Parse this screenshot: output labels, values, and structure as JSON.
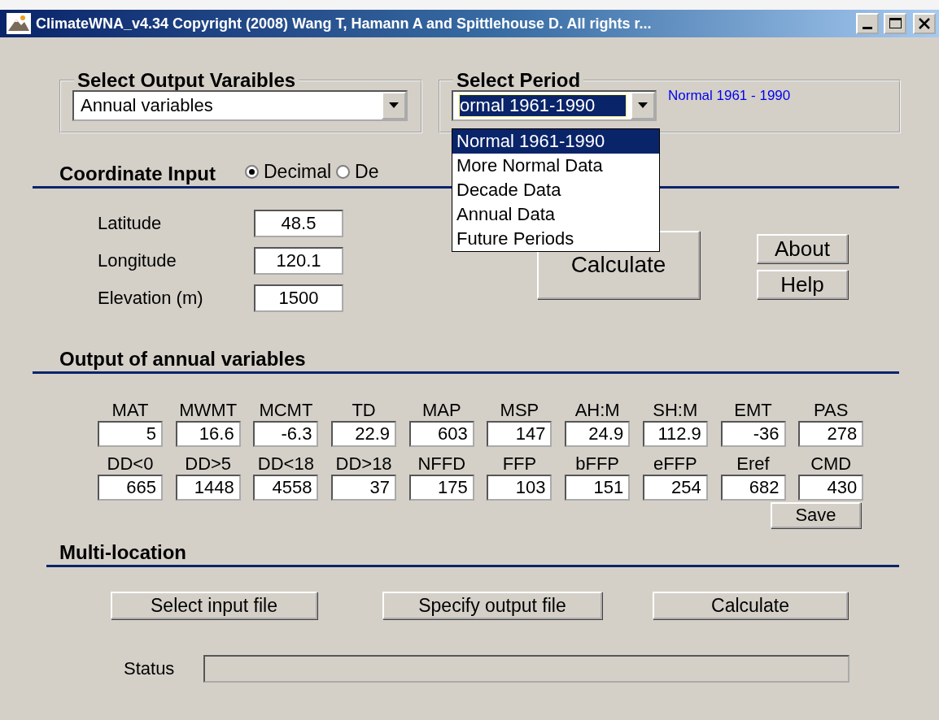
{
  "window": {
    "title": "ClimateWNA_v4.34  Copyright (2008) Wang T, Hamann A and  Spittlehouse D. All rights r..."
  },
  "output_variables": {
    "label": "Select Output Varaibles",
    "value": "Annual variables"
  },
  "period": {
    "label": "Select Period",
    "value": "ormal 1961-1990",
    "note": "Normal 1961 - 1990",
    "expanded": true,
    "options": [
      {
        "label": "Normal 1961-1990",
        "selected": true
      },
      {
        "label": "More Normal Data",
        "selected": false
      },
      {
        "label": "Decade Data",
        "selected": false
      },
      {
        "label": "Annual Data",
        "selected": false
      },
      {
        "label": "Future Periods",
        "selected": false
      }
    ]
  },
  "coordinate_input": {
    "heading": "Coordinate Input",
    "formats": [
      {
        "label": "Decimal",
        "selected": true
      },
      {
        "label": "De",
        "selected": false
      }
    ],
    "fields": [
      {
        "label": "Latitude",
        "value": "48.5"
      },
      {
        "label": "Longitude",
        "value": "120.1"
      },
      {
        "label": "Elevation (m)",
        "value": "1500"
      }
    ]
  },
  "actions": {
    "calculate": "Calculate",
    "about": "About",
    "help": "Help"
  },
  "output": {
    "heading": "Output of annual variables",
    "rows": [
      [
        {
          "label": "MAT",
          "value": "5"
        },
        {
          "label": "MWMT",
          "value": "16.6"
        },
        {
          "label": "MCMT",
          "value": "-6.3"
        },
        {
          "label": "TD",
          "value": "22.9"
        },
        {
          "label": "MAP",
          "value": "603"
        },
        {
          "label": "MSP",
          "value": "147"
        },
        {
          "label": "AH:M",
          "value": "24.9"
        },
        {
          "label": "SH:M",
          "value": "112.9"
        },
        {
          "label": "EMT",
          "value": "-36"
        },
        {
          "label": "PAS",
          "value": "278"
        }
      ],
      [
        {
          "label": "DD<0",
          "value": "665"
        },
        {
          "label": "DD>5",
          "value": "1448"
        },
        {
          "label": "DD<18",
          "value": "4558"
        },
        {
          "label": "DD>18",
          "value": "37"
        },
        {
          "label": "NFFD",
          "value": "175"
        },
        {
          "label": "FFP",
          "value": "103"
        },
        {
          "label": "bFFP",
          "value": "151"
        },
        {
          "label": "eFFP",
          "value": "254"
        },
        {
          "label": "Eref",
          "value": "682"
        },
        {
          "label": "CMD",
          "value": "430"
        }
      ]
    ],
    "save": "Save"
  },
  "multi_location": {
    "heading": "Multi-location",
    "buttons": [
      "Select input file",
      "Specify output file",
      "Calculate"
    ],
    "status_label": "Status"
  }
}
